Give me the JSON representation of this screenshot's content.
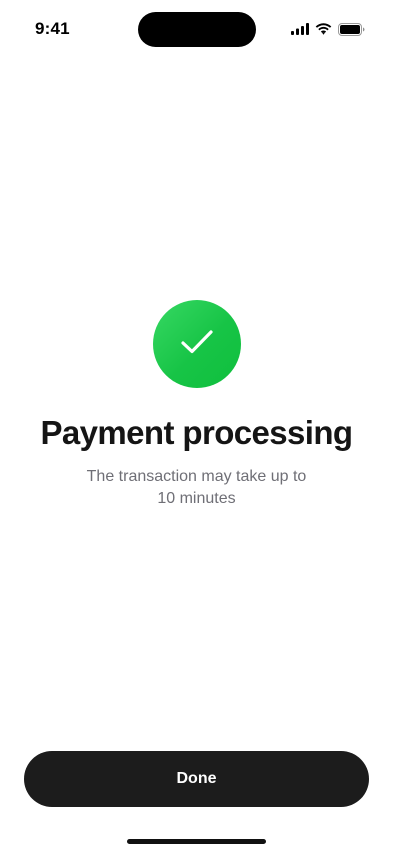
{
  "status_bar": {
    "time": "9:41",
    "icons": [
      "signal-icon",
      "wifi-icon",
      "battery-icon"
    ]
  },
  "main": {
    "status_icon": "checkmark-icon",
    "title": "Payment processing",
    "subtitle": "The transaction may take up to 10 minutes"
  },
  "actions": {
    "done_label": "Done"
  },
  "colors": {
    "success": "#1CC74B",
    "button_bg": "#1C1C1C",
    "subtitle_text": "#6F6F76"
  }
}
